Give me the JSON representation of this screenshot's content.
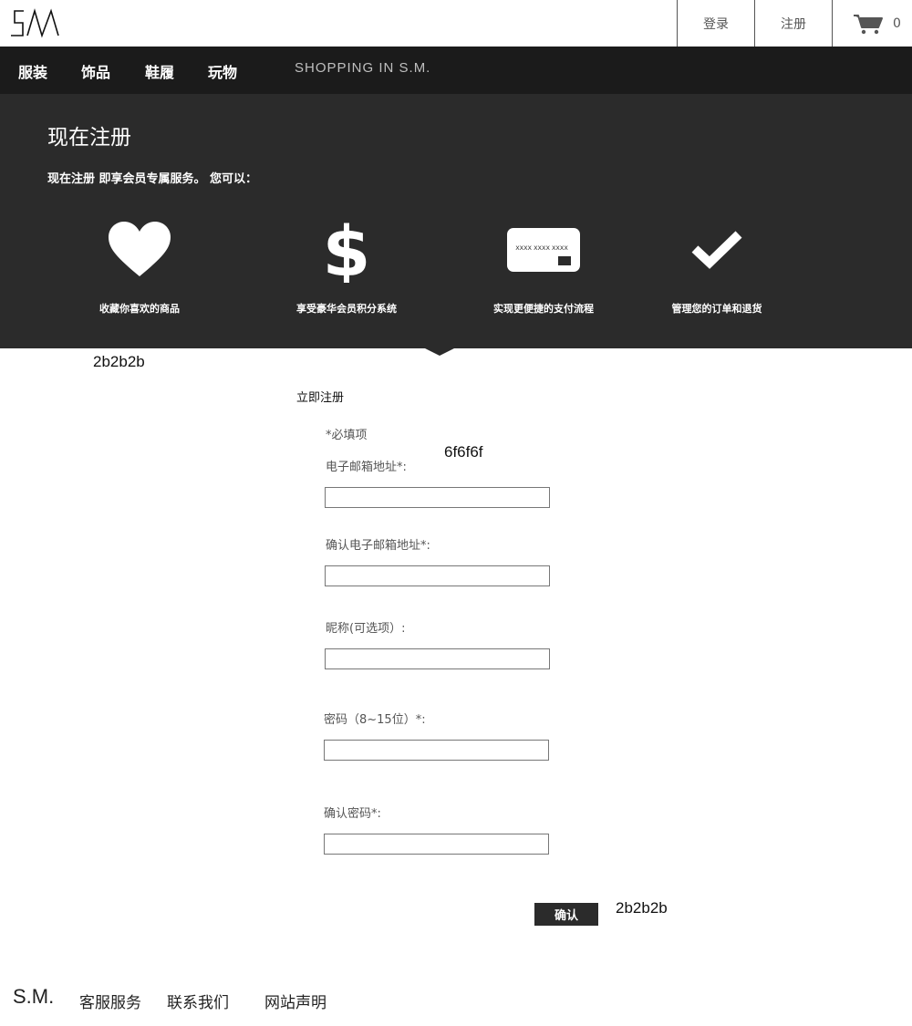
{
  "header": {
    "logo": "SM",
    "login_label": "登录",
    "register_label": "注册",
    "cart_count": "0",
    "icons": [
      "cart-icon"
    ]
  },
  "nav": {
    "items": [
      {
        "label": "服装"
      },
      {
        "label": "饰品"
      },
      {
        "label": "鞋履"
      },
      {
        "label": "玩物"
      }
    ],
    "tagline": "SHOPPING IN S.M."
  },
  "banner": {
    "title": "现在注册",
    "subtitle": "现在注册 即享会员专属服务。 您可以：",
    "benefits": [
      {
        "icon": "heart-icon",
        "label": "收藏你喜欢的商品"
      },
      {
        "icon": "dollar-icon",
        "label": "享受豪华会员积分系统"
      },
      {
        "icon": "credit-card-icon",
        "label": "实现更便捷的支付流程",
        "card_text": "XXXX XXXX XXXX"
      },
      {
        "icon": "checkmark-icon",
        "label": "管理您的订单和退货"
      }
    ]
  },
  "annotations": {
    "banner_color": "2b2b2b",
    "label_color": "6f6f6f",
    "button_color": "2b2b2b"
  },
  "form": {
    "heading": "立即注册",
    "required_note": "*必填项",
    "fields": [
      {
        "label": "电子邮箱地址*:",
        "value": ""
      },
      {
        "label": "确认电子邮箱地址*:",
        "value": ""
      },
      {
        "label": "昵称(可选项）:",
        "value": ""
      },
      {
        "label": "密码（8~15位）*:",
        "value": ""
      },
      {
        "label": "确认密码*:",
        "value": ""
      }
    ],
    "submit_label": "确认"
  },
  "footer": {
    "logo": "S.M.",
    "links": [
      {
        "label": "客服服务"
      },
      {
        "label": "联系我们"
      },
      {
        "label": "网站声明"
      }
    ]
  },
  "colors": {
    "banner_bg": "#2b2b2b",
    "nav_bg": "#1b1b1b",
    "label_text": "#6f6f6f",
    "button_bg": "#2b2b2b"
  }
}
